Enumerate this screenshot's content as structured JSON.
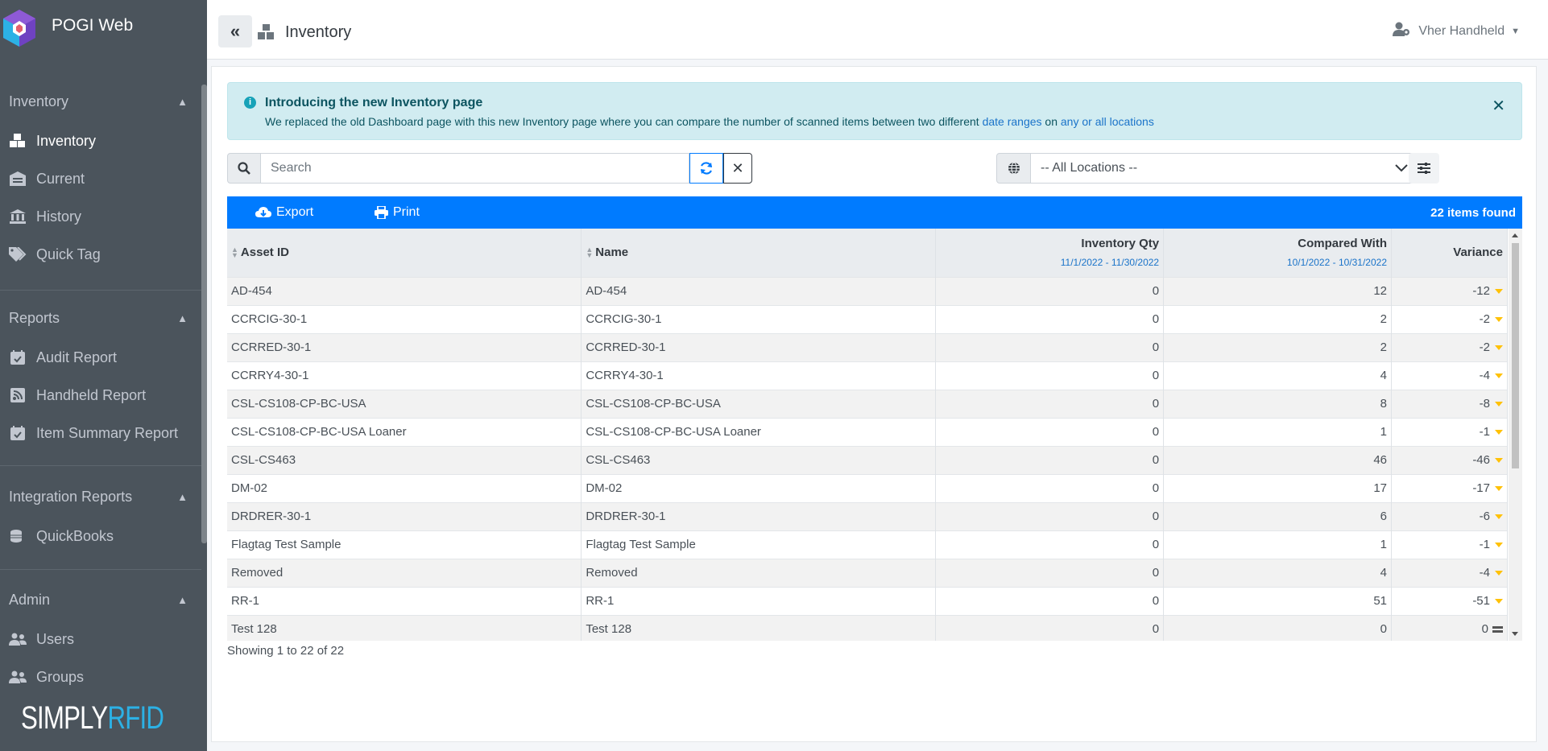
{
  "brand": {
    "name": "POGI Web",
    "footer_part1": "SIMPLY",
    "footer_part2": "RFID"
  },
  "sidebar": {
    "sections": [
      {
        "header": "Inventory",
        "items": [
          {
            "label": "Inventory",
            "icon": "cubes-icon",
            "active": true
          },
          {
            "label": "Current",
            "icon": "warehouse-icon"
          },
          {
            "label": "History",
            "icon": "bank-icon"
          },
          {
            "label": "Quick Tag",
            "icon": "tags-icon"
          }
        ]
      },
      {
        "header": "Reports",
        "items": [
          {
            "label": "Audit Report",
            "icon": "calendar-check-icon"
          },
          {
            "label": "Handheld Report",
            "icon": "rss-square-icon"
          },
          {
            "label": "Item Summary Report",
            "icon": "calendar-check-icon"
          }
        ]
      },
      {
        "header": "Integration Reports",
        "items": [
          {
            "label": "QuickBooks",
            "icon": "coins-icon"
          }
        ]
      },
      {
        "header": "Admin",
        "items": [
          {
            "label": "Users",
            "icon": "users-icon"
          },
          {
            "label": "Groups",
            "icon": "users-icon"
          }
        ]
      }
    ]
  },
  "topbar": {
    "page_title": "Inventory",
    "user_name": "Vher Handheld"
  },
  "alert": {
    "title": "Introducing the new Inventory page",
    "body_pre": "We replaced the old Dashboard page with this new Inventory page where you can compare the number of scanned items between two different ",
    "link1": "date ranges",
    "body_mid": " on ",
    "link2": "any or all locations"
  },
  "search": {
    "placeholder": "Search"
  },
  "location": {
    "selected": "-- All Locations --"
  },
  "toolbar": {
    "export_label": "Export",
    "print_label": "Print",
    "count_label": "22 items found"
  },
  "table": {
    "headers": {
      "asset_id": "Asset ID",
      "name": "Name",
      "inventory_qty": "Inventory Qty",
      "inventory_range": "11/1/2022 - 11/30/2022",
      "compared_with": "Compared With",
      "compared_range": "10/1/2022 - 10/31/2022",
      "variance": "Variance"
    },
    "rows": [
      {
        "asset_id": "AD-454",
        "name": "AD-454",
        "qty": "0",
        "compared": "12",
        "variance": "-12",
        "trend": "down"
      },
      {
        "asset_id": "CCRCIG-30-1",
        "name": "CCRCIG-30-1",
        "qty": "0",
        "compared": "2",
        "variance": "-2",
        "trend": "down"
      },
      {
        "asset_id": "CCRRED-30-1",
        "name": "CCRRED-30-1",
        "qty": "0",
        "compared": "2",
        "variance": "-2",
        "trend": "down"
      },
      {
        "asset_id": "CCRRY4-30-1",
        "name": "CCRRY4-30-1",
        "qty": "0",
        "compared": "4",
        "variance": "-4",
        "trend": "down"
      },
      {
        "asset_id": "CSL-CS108-CP-BC-USA",
        "name": "CSL-CS108-CP-BC-USA",
        "qty": "0",
        "compared": "8",
        "variance": "-8",
        "trend": "down"
      },
      {
        "asset_id": "CSL-CS108-CP-BC-USA Loaner",
        "name": "CSL-CS108-CP-BC-USA Loaner",
        "qty": "0",
        "compared": "1",
        "variance": "-1",
        "trend": "down"
      },
      {
        "asset_id": "CSL-CS463",
        "name": "CSL-CS463",
        "qty": "0",
        "compared": "46",
        "variance": "-46",
        "trend": "down"
      },
      {
        "asset_id": "DM-02",
        "name": "DM-02",
        "qty": "0",
        "compared": "17",
        "variance": "-17",
        "trend": "down"
      },
      {
        "asset_id": "DRDRER-30-1",
        "name": "DRDRER-30-1",
        "qty": "0",
        "compared": "6",
        "variance": "-6",
        "trend": "down"
      },
      {
        "asset_id": "Flagtag Test Sample",
        "name": "Flagtag Test Sample",
        "qty": "0",
        "compared": "1",
        "variance": "-1",
        "trend": "down"
      },
      {
        "asset_id": "Removed",
        "name": "Removed",
        "qty": "0",
        "compared": "4",
        "variance": "-4",
        "trend": "down"
      },
      {
        "asset_id": "RR-1",
        "name": "RR-1",
        "qty": "0",
        "compared": "51",
        "variance": "-51",
        "trend": "down"
      },
      {
        "asset_id": "Test 128",
        "name": "Test 128",
        "qty": "0",
        "compared": "0",
        "variance": "0",
        "trend": "equal"
      }
    ]
  },
  "footer": {
    "showing": "Showing 1 to 22 of 22"
  }
}
